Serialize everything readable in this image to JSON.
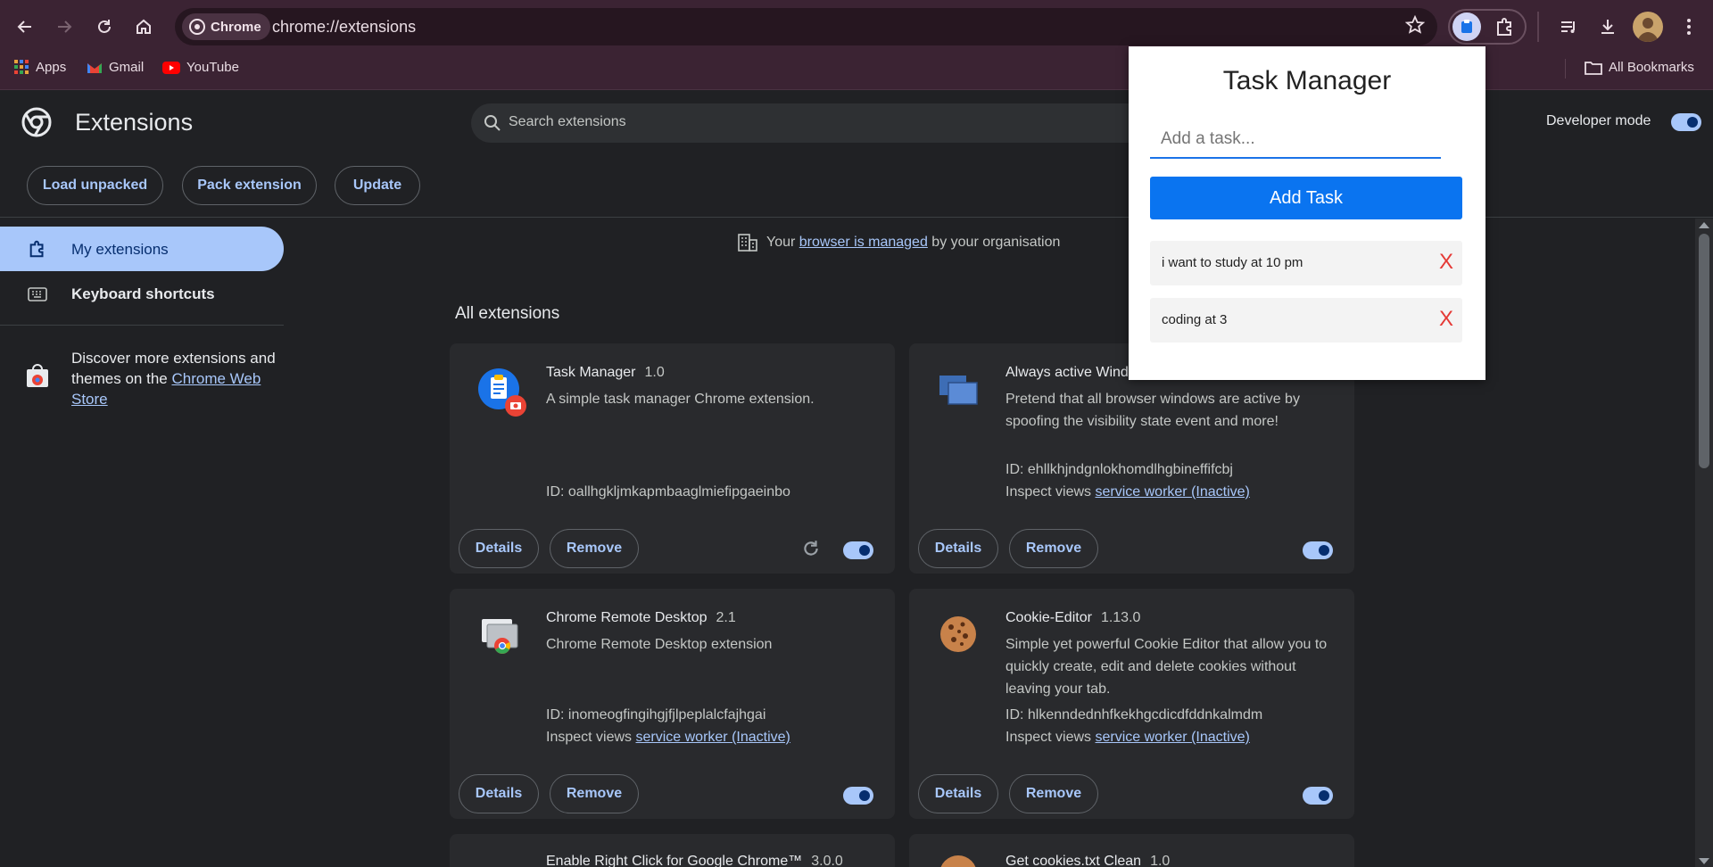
{
  "browser": {
    "url": "chrome://extensions",
    "chip_label": "Chrome",
    "bookmarks": [
      "Apps",
      "Gmail",
      "YouTube"
    ],
    "all_bookmarks": "All Bookmarks"
  },
  "header": {
    "title": "Extensions",
    "search_placeholder": "Search extensions",
    "developer_mode": "Developer mode",
    "buttons": {
      "load": "Load unpacked",
      "pack": "Pack extension",
      "update": "Update"
    }
  },
  "sidebar": {
    "my_extensions": "My extensions",
    "keyboard_shortcuts": "Keyboard shortcuts",
    "discover_text": "Discover more extensions and themes on the ",
    "discover_link": "Chrome Web Store"
  },
  "main": {
    "managed_prefix": "Your ",
    "managed_link": "browser is managed",
    "managed_suffix": " by your organisation",
    "section_title": "All extensions",
    "details": "Details",
    "remove": "Remove",
    "inspect_label": "Inspect views",
    "service_worker": "service worker (Inactive)",
    "cards": [
      {
        "name": "Task Manager",
        "version": "1.0",
        "desc": "A simple task manager Chrome extension.",
        "id": "ID: oallhgkljmkapmbaaglmiefipgaeinbo"
      },
      {
        "name": "Always active Window",
        "version": "",
        "desc": "Pretend that all browser windows are active by spoofing the visibility state event and more!",
        "id": "ID: ehllkhjndgnlokhomdlhgbineffifcbj"
      },
      {
        "name": "Chrome Remote Desktop",
        "version": "2.1",
        "desc": "Chrome Remote Desktop extension",
        "id": "ID: inomeogfingihgjfjlpeplalcfajhgai"
      },
      {
        "name": "Cookie-Editor",
        "version": "1.13.0",
        "desc": "Simple yet powerful Cookie Editor that allow you to quickly create, edit and delete cookies without leaving your tab.",
        "id": "ID: hlkenndednhfkekhgcdicdfddnkalmdm"
      },
      {
        "name": "Enable Right Click for Google Chrome™",
        "version": "3.0.0",
        "desc": "",
        "id": ""
      },
      {
        "name": "Get cookies.txt Clean",
        "version": "1.0",
        "desc": "",
        "id": ""
      }
    ]
  },
  "popup": {
    "title": "Task Manager",
    "input_placeholder": "Add a task...",
    "add_button": "Add Task",
    "tasks": [
      {
        "text": "i want to study at 10 pm",
        "delete": "X"
      },
      {
        "text": "coding at 3",
        "delete": "X"
      }
    ]
  },
  "colors": {
    "accent": "#a8c7fa",
    "popup_button": "#0a74f0",
    "delete": "#e53935",
    "frame": "#3b2333"
  }
}
